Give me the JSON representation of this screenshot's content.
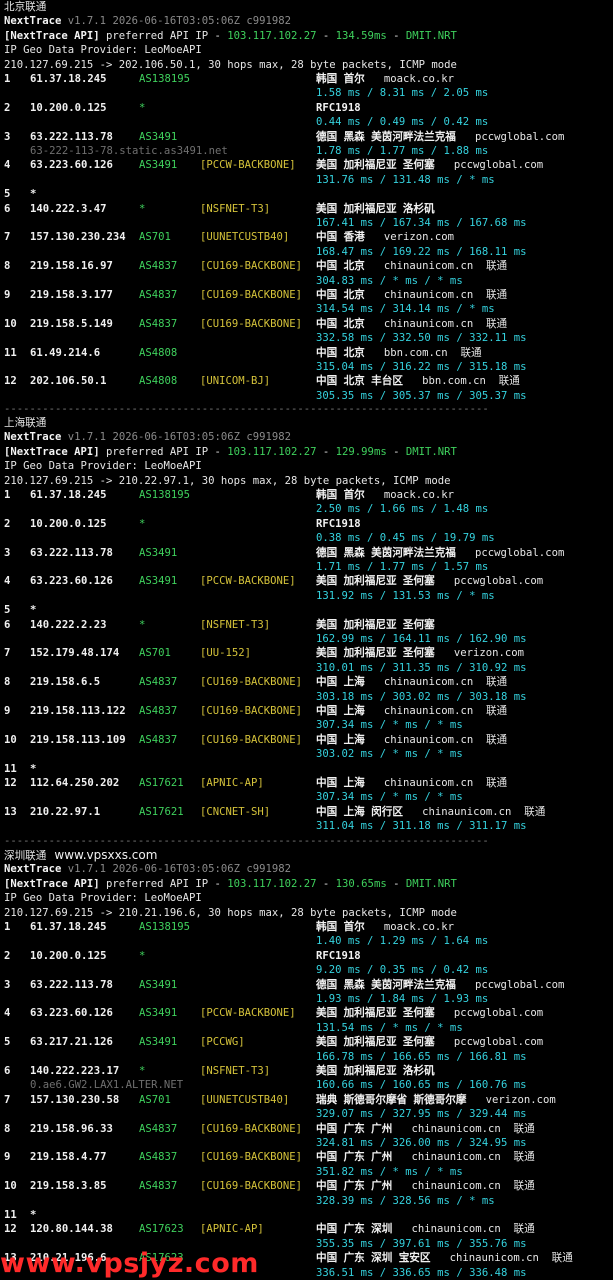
{
  "watermark_bottom": "www.vpsjyz.com",
  "sections": [
    {
      "title": "北京联通",
      "watermark": "",
      "version_line": {
        "name": "NextTrace",
        "version": "v1.7.1 2026-06-16T03:05:06Z c991982"
      },
      "api_line": {
        "tag": "[NextTrace API]",
        "text": " preferred API IP - ",
        "ip": "103.117.102.27",
        "dash1": " - ",
        "ms": "134.59ms",
        "dash2": " - ",
        "node": "DMIT.NRT"
      },
      "geo_provider": "IP Geo Data Provider: LeoMoeAPI",
      "route_line": "210.127.69.215 -> 202.106.50.1, 30 hops max, 28 byte packets, ICMP mode",
      "hops": [
        {
          "n": "1",
          "ip": "61.37.18.245",
          "as": "AS138195",
          "net": "",
          "geo": "韩国 首尔",
          "dom": "moack.co.kr",
          "rt": "1.58 ms / 8.31 ms / 2.05 ms",
          "rdns": ""
        },
        {
          "n": "2",
          "ip": "10.200.0.125",
          "as": "*",
          "net": "",
          "geo": "RFC1918",
          "dom": "",
          "rt": "0.44 ms / 0.49 ms / 0.42 ms",
          "rdns": ""
        },
        {
          "n": "3",
          "ip": "63.222.113.78",
          "as": "AS3491",
          "net": "",
          "geo": "德国 黑森 美茵河畔法兰克福",
          "dom": "pccwglobal.com",
          "rt": "1.78 ms / 1.77 ms / 1.88 ms",
          "rdns": "63-222-113-78.static.as3491.net"
        },
        {
          "n": "4",
          "ip": "63.223.60.126",
          "as": "AS3491",
          "net": "[PCCW-BACKBONE]",
          "geo": "美国 加利福尼亚 圣何塞",
          "dom": "pccwglobal.com",
          "rt": "131.76 ms / 131.48 ms / * ms",
          "rdns": ""
        },
        {
          "n": "5",
          "ip": "*",
          "as": "",
          "net": "",
          "geo": "",
          "dom": "",
          "rt": "",
          "rdns": ""
        },
        {
          "n": "6",
          "ip": "140.222.3.47",
          "as": "*",
          "net": "[NSFNET-T3]",
          "geo": "美国 加利福尼亚 洛杉矶",
          "dom": "",
          "rt": "167.41 ms / 167.34 ms / 167.68 ms",
          "rdns": ""
        },
        {
          "n": "7",
          "ip": "157.130.230.234",
          "as": "AS701",
          "net": "[UUNETCUSTB40]",
          "geo": "中国 香港",
          "dom": "verizon.com",
          "rt": "168.47 ms / 169.22 ms / 168.11 ms",
          "rdns": ""
        },
        {
          "n": "8",
          "ip": "219.158.16.97",
          "as": "AS4837",
          "net": "[CU169-BACKBONE]",
          "geo": "中国 北京",
          "dom": "chinaunicom.cn  联通",
          "rt": "304.83 ms / * ms / * ms",
          "rdns": ""
        },
        {
          "n": "9",
          "ip": "219.158.3.177",
          "as": "AS4837",
          "net": "[CU169-BACKBONE]",
          "geo": "中国 北京",
          "dom": "chinaunicom.cn  联通",
          "rt": "314.54 ms / 314.14 ms / * ms",
          "rdns": ""
        },
        {
          "n": "10",
          "ip": "219.158.5.149",
          "as": "AS4837",
          "net": "[CU169-BACKBONE]",
          "geo": "中国 北京",
          "dom": "chinaunicom.cn  联通",
          "rt": "332.58 ms / 332.50 ms / 332.11 ms",
          "rdns": ""
        },
        {
          "n": "11",
          "ip": "61.49.214.6",
          "as": "AS4808",
          "net": "",
          "geo": "中国 北京",
          "dom": "bbn.com.cn  联通",
          "rt": "315.04 ms / 316.22 ms / 315.18 ms",
          "rdns": ""
        },
        {
          "n": "12",
          "ip": "202.106.50.1",
          "as": "AS4808",
          "net": "[UNICOM-BJ]",
          "geo": "中国 北京 丰台区",
          "dom": "bbn.com.cn  联通",
          "rt": "305.35 ms / 305.37 ms / 305.37 ms",
          "rdns": ""
        }
      ]
    },
    {
      "title": "上海联通",
      "watermark": "",
      "version_line": {
        "name": "NextTrace",
        "version": "v1.7.1 2026-06-16T03:05:06Z c991982"
      },
      "api_line": {
        "tag": "[NextTrace API]",
        "text": " preferred API IP - ",
        "ip": "103.117.102.27",
        "dash1": " - ",
        "ms": "129.99ms",
        "dash2": " - ",
        "node": "DMIT.NRT"
      },
      "geo_provider": "IP Geo Data Provider: LeoMoeAPI",
      "route_line": "210.127.69.215 -> 210.22.97.1, 30 hops max, 28 byte packets, ICMP mode",
      "hops": [
        {
          "n": "1",
          "ip": "61.37.18.245",
          "as": "AS138195",
          "net": "",
          "geo": "韩国 首尔",
          "dom": "moack.co.kr",
          "rt": "2.50 ms / 1.66 ms / 1.48 ms",
          "rdns": ""
        },
        {
          "n": "2",
          "ip": "10.200.0.125",
          "as": "*",
          "net": "",
          "geo": "RFC1918",
          "dom": "",
          "rt": "0.38 ms / 0.45 ms / 19.79 ms",
          "rdns": ""
        },
        {
          "n": "3",
          "ip": "63.222.113.78",
          "as": "AS3491",
          "net": "",
          "geo": "德国 黑森 美茵河畔法兰克福",
          "dom": "pccwglobal.com",
          "rt": "1.71 ms / 1.77 ms / 1.57 ms",
          "rdns": ""
        },
        {
          "n": "4",
          "ip": "63.223.60.126",
          "as": "AS3491",
          "net": "[PCCW-BACKBONE]",
          "geo": "美国 加利福尼亚 圣何塞",
          "dom": "pccwglobal.com",
          "rt": "131.92 ms / 131.53 ms / * ms",
          "rdns": ""
        },
        {
          "n": "5",
          "ip": "*",
          "as": "",
          "net": "",
          "geo": "",
          "dom": "",
          "rt": "",
          "rdns": ""
        },
        {
          "n": "6",
          "ip": "140.222.2.23",
          "as": "*",
          "net": "[NSFNET-T3]",
          "geo": "美国 加利福尼亚 圣何塞",
          "dom": "",
          "rt": "162.99 ms / 164.11 ms / 162.90 ms",
          "rdns": ""
        },
        {
          "n": "7",
          "ip": "152.179.48.174",
          "as": "AS701",
          "net": "[UU-152]",
          "geo": "美国 加利福尼亚 圣何塞",
          "dom": "verizon.com",
          "rt": "310.01 ms / 311.35 ms / 310.92 ms",
          "rdns": ""
        },
        {
          "n": "8",
          "ip": "219.158.6.5",
          "as": "AS4837",
          "net": "[CU169-BACKBONE]",
          "geo": "中国 上海",
          "dom": "chinaunicom.cn  联通",
          "rt": "303.18 ms / 303.02 ms / 303.18 ms",
          "rdns": ""
        },
        {
          "n": "9",
          "ip": "219.158.113.122",
          "as": "AS4837",
          "net": "[CU169-BACKBONE]",
          "geo": "中国 上海",
          "dom": "chinaunicom.cn  联通",
          "rt": "307.34 ms / * ms / * ms",
          "rdns": ""
        },
        {
          "n": "10",
          "ip": "219.158.113.109",
          "as": "AS4837",
          "net": "[CU169-BACKBONE]",
          "geo": "中国 上海",
          "dom": "chinaunicom.cn  联通",
          "rt": "303.02 ms / * ms / * ms",
          "rdns": ""
        },
        {
          "n": "11",
          "ip": "*",
          "as": "",
          "net": "",
          "geo": "",
          "dom": "",
          "rt": "",
          "rdns": ""
        },
        {
          "n": "12",
          "ip": "112.64.250.202",
          "as": "AS17621",
          "net": "[APNIC-AP]",
          "geo": "中国 上海",
          "dom": "chinaunicom.cn  联通",
          "rt": "307.34 ms / * ms / * ms",
          "rdns": ""
        },
        {
          "n": "13",
          "ip": "210.22.97.1",
          "as": "AS17621",
          "net": "[CNCNET-SH]",
          "geo": "中国 上海 闵行区",
          "dom": "chinaunicom.cn  联通",
          "rt": "311.04 ms / 311.18 ms / 311.17 ms",
          "rdns": ""
        }
      ]
    },
    {
      "title": "深圳联通",
      "watermark": "www.vpsxxs.com",
      "version_line": {
        "name": "NextTrace",
        "version": "v1.7.1 2026-06-16T03:05:06Z c991982"
      },
      "api_line": {
        "tag": "[NextTrace API]",
        "text": " preferred API IP - ",
        "ip": "103.117.102.27",
        "dash1": " - ",
        "ms": "130.65ms",
        "dash2": " - ",
        "node": "DMIT.NRT"
      },
      "geo_provider": "IP Geo Data Provider: LeoMoeAPI",
      "route_line": "210.127.69.215 -> 210.21.196.6, 30 hops max, 28 byte packets, ICMP mode",
      "hops": [
        {
          "n": "1",
          "ip": "61.37.18.245",
          "as": "AS138195",
          "net": "",
          "geo": "韩国 首尔",
          "dom": "moack.co.kr",
          "rt": "1.40 ms / 1.29 ms / 1.64 ms",
          "rdns": ""
        },
        {
          "n": "2",
          "ip": "10.200.0.125",
          "as": "*",
          "net": "",
          "geo": "RFC1918",
          "dom": "",
          "rt": "9.20 ms / 0.35 ms / 0.42 ms",
          "rdns": ""
        },
        {
          "n": "3",
          "ip": "63.222.113.78",
          "as": "AS3491",
          "net": "",
          "geo": "德国 黑森 美茵河畔法兰克福",
          "dom": "pccwglobal.com",
          "rt": "1.93 ms / 1.84 ms / 1.93 ms",
          "rdns": ""
        },
        {
          "n": "4",
          "ip": "63.223.60.126",
          "as": "AS3491",
          "net": "[PCCW-BACKBONE]",
          "geo": "美国 加利福尼亚 圣何塞",
          "dom": "pccwglobal.com",
          "rt": "131.54 ms / * ms / * ms",
          "rdns": ""
        },
        {
          "n": "5",
          "ip": "63.217.21.126",
          "as": "AS3491",
          "net": "[PCCWG]",
          "geo": "美国 加利福尼亚 圣何塞",
          "dom": "pccwglobal.com",
          "rt": "166.78 ms / 166.65 ms / 166.81 ms",
          "rdns": ""
        },
        {
          "n": "6",
          "ip": "140.222.223.17",
          "as": "*",
          "net": "[NSFNET-T3]",
          "geo": "美国 加利福尼亚 洛杉矶",
          "dom": "",
          "rt": "160.66 ms / 160.65 ms / 160.76 ms",
          "rdns": "0.ae6.GW2.LAX1.ALTER.NET"
        },
        {
          "n": "7",
          "ip": "157.130.230.58",
          "as": "AS701",
          "net": "[UUNETCUSTB40]",
          "geo": "瑞典 斯德哥尔摩省 斯德哥尔摩",
          "dom": "verizon.com",
          "rt": "329.07 ms / 327.95 ms / 329.44 ms",
          "rdns": ""
        },
        {
          "n": "8",
          "ip": "219.158.96.33",
          "as": "AS4837",
          "net": "[CU169-BACKBONE]",
          "geo": "中国 广东 广州",
          "dom": "chinaunicom.cn  联通",
          "rt": "324.81 ms / 326.00 ms / 324.95 ms",
          "rdns": ""
        },
        {
          "n": "9",
          "ip": "219.158.4.77",
          "as": "AS4837",
          "net": "[CU169-BACKBONE]",
          "geo": "中国 广东 广州",
          "dom": "chinaunicom.cn  联通",
          "rt": "351.82 ms / * ms / * ms",
          "rdns": ""
        },
        {
          "n": "10",
          "ip": "219.158.3.85",
          "as": "AS4837",
          "net": "[CU169-BACKBONE]",
          "geo": "中国 广东 广州",
          "dom": "chinaunicom.cn  联通",
          "rt": "328.39 ms / 328.56 ms / * ms",
          "rdns": ""
        },
        {
          "n": "11",
          "ip": "*",
          "as": "",
          "net": "",
          "geo": "",
          "dom": "",
          "rt": "",
          "rdns": ""
        },
        {
          "n": "12",
          "ip": "120.80.144.38",
          "as": "AS17623",
          "net": "[APNIC-AP]",
          "geo": "中国 广东 深圳",
          "dom": "chinaunicom.cn  联通",
          "rt": "355.35 ms / 397.61 ms / 355.76 ms",
          "rdns": ""
        },
        {
          "n": "13",
          "ip": "210.21.196.6",
          "as": "AS17623",
          "net": "",
          "geo": "中国 广东 深圳 宝安区",
          "dom": "chinaunicom.cn  联通",
          "rt": "336.51 ms / 336.65 ms / 336.48 ms",
          "rdns": ""
        }
      ]
    }
  ],
  "separator": "----------------------------------------------------------------------------"
}
